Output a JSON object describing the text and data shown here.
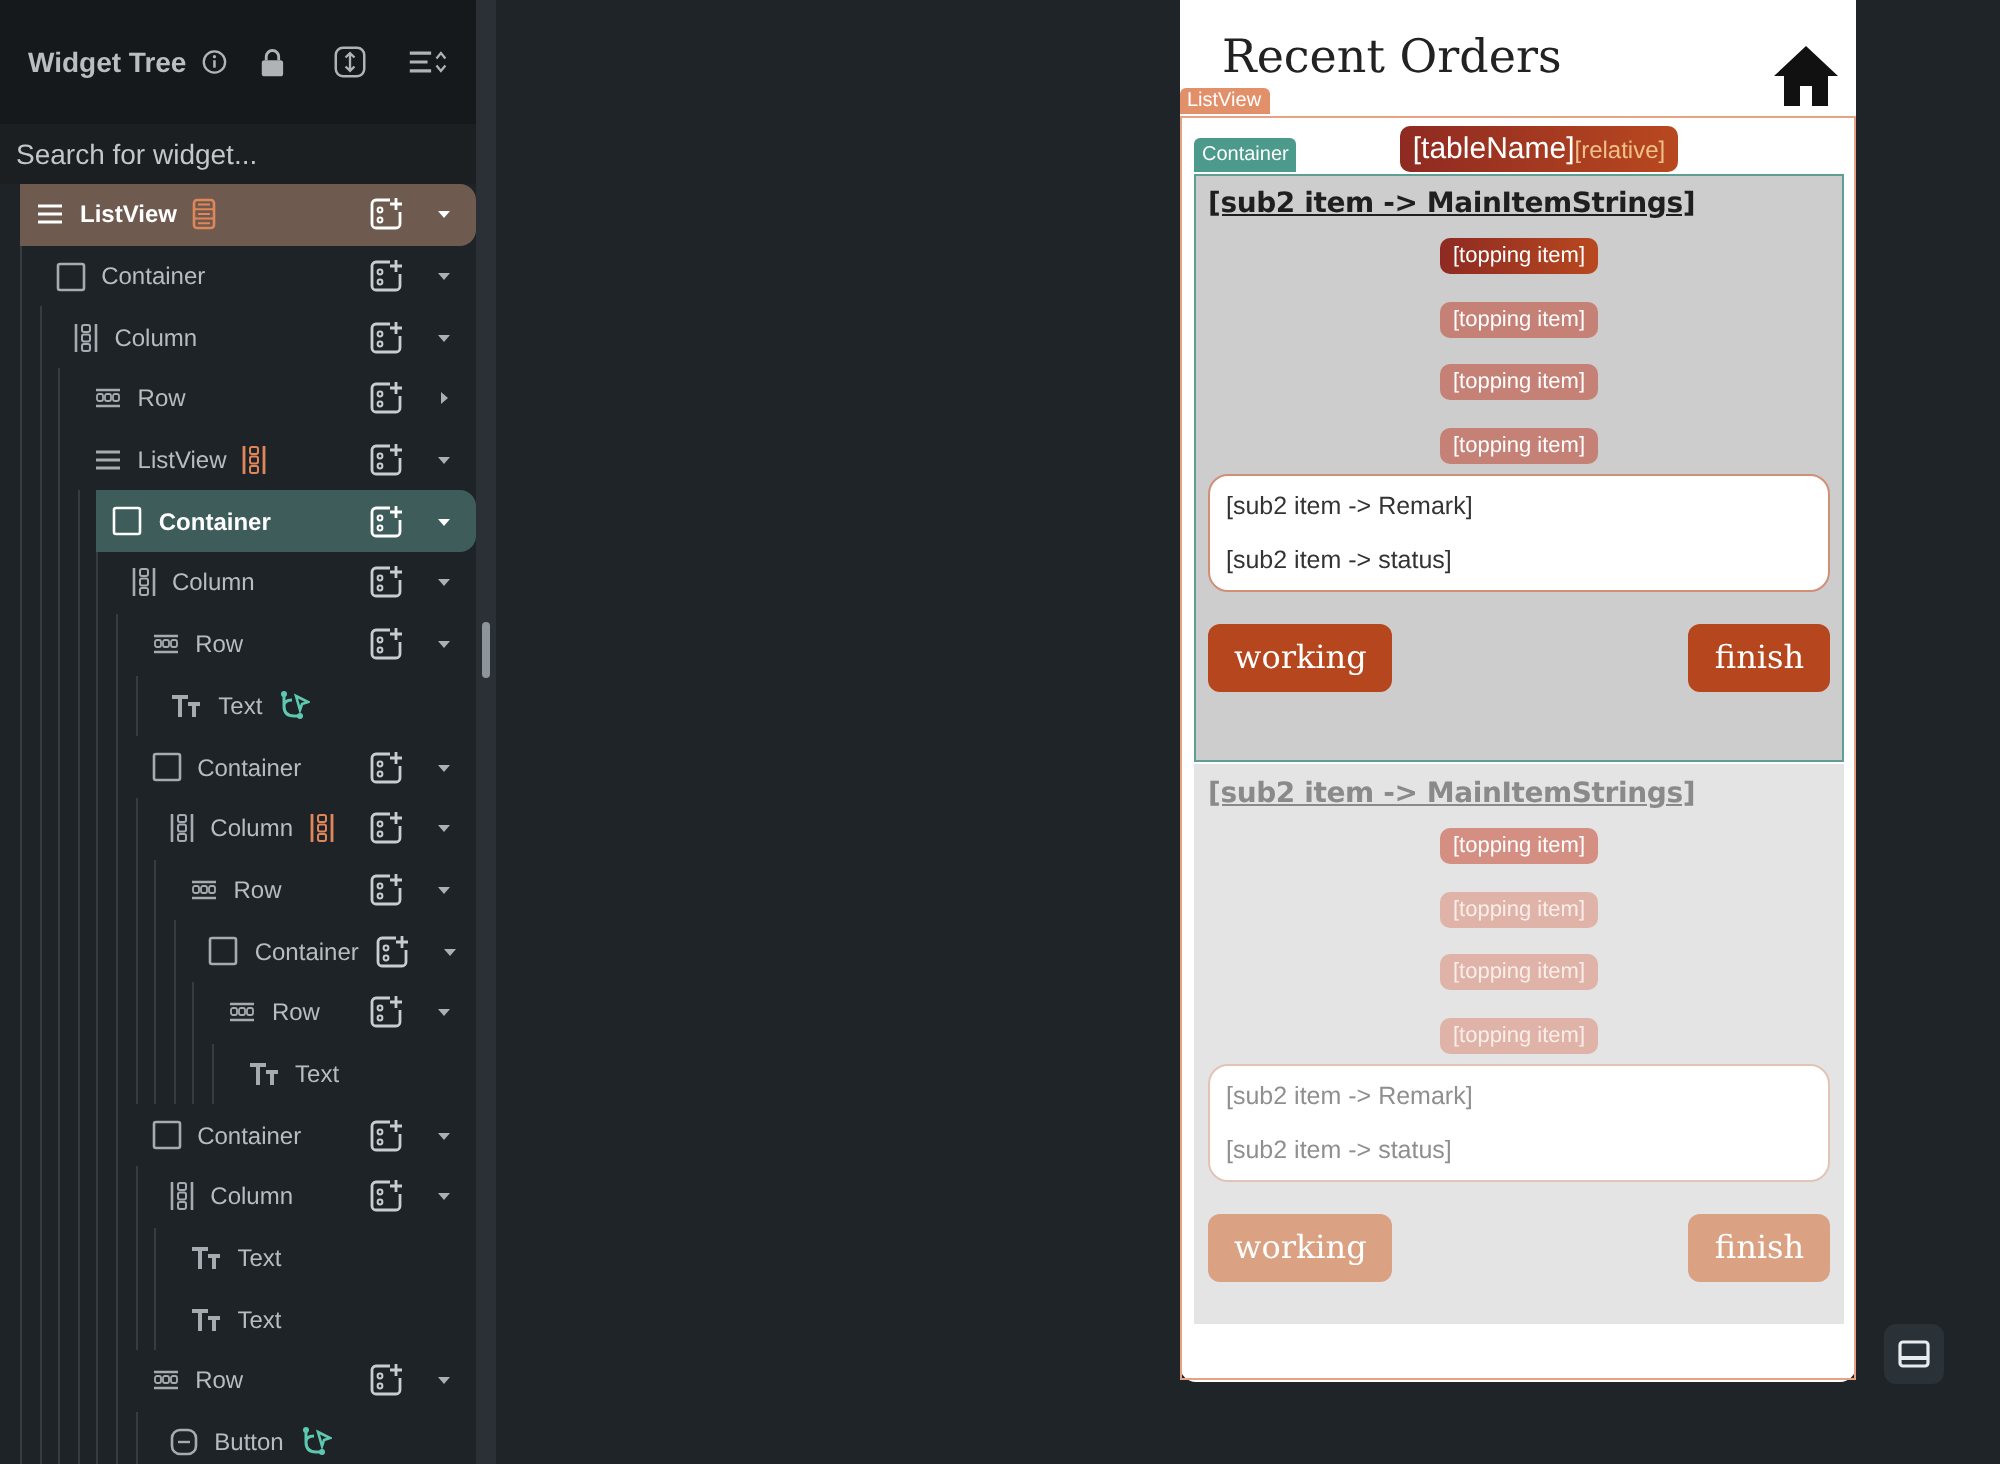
{
  "widget_tree": {
    "title": "Widget Tree",
    "search": {
      "placeholder": "Search for widget..."
    },
    "items": [
      {
        "kind": "listview",
        "label": "ListView",
        "highlighted": true,
        "selected": false,
        "badge": {
          "kind": "list"
        },
        "addable": true,
        "expanded": true,
        "children": [
          {
            "kind": "container",
            "label": "Container",
            "highlighted": false,
            "selected": false,
            "addable": true,
            "expanded": true,
            "children": [
              {
                "kind": "column",
                "label": "Column",
                "highlighted": false,
                "selected": false,
                "addable": true,
                "expanded": true,
                "children": [
                  {
                    "kind": "row",
                    "label": "Row",
                    "highlighted": false,
                    "selected": false,
                    "addable": true,
                    "expanded": false
                  },
                  {
                    "kind": "listview",
                    "label": "ListView",
                    "highlighted": false,
                    "selected": false,
                    "badge": {
                      "kind": "column"
                    },
                    "addable": true,
                    "expanded": true,
                    "children": [
                      {
                        "kind": "container",
                        "label": "Container",
                        "highlighted": false,
                        "selected": true,
                        "addable": true,
                        "expanded": true,
                        "children": [
                          {
                            "kind": "column",
                            "label": "Column",
                            "highlighted": false,
                            "selected": false,
                            "addable": true,
                            "expanded": true,
                            "children": [
                              {
                                "kind": "row",
                                "label": "Row",
                                "highlighted": false,
                                "selected": false,
                                "addable": true,
                                "expanded": true,
                                "children": [
                                  {
                                    "kind": "text",
                                    "label": "Text",
                                    "highlighted": false,
                                    "selected": false,
                                    "badge": {
                                      "kind": "action"
                                    },
                                    "addable": false
                                  }
                                ]
                              },
                              {
                                "kind": "container",
                                "label": "Container",
                                "highlighted": false,
                                "selected": false,
                                "addable": true,
                                "expanded": true,
                                "children": [
                                  {
                                    "kind": "column",
                                    "label": "Column",
                                    "highlighted": false,
                                    "selected": false,
                                    "badge": {
                                      "kind": "column"
                                    },
                                    "addable": true,
                                    "expanded": true,
                                    "children": [
                                      {
                                        "kind": "row",
                                        "label": "Row",
                                        "highlighted": false,
                                        "selected": false,
                                        "addable": true,
                                        "expanded": true,
                                        "children": [
                                          {
                                            "kind": "container",
                                            "label": "Container",
                                            "highlighted": false,
                                            "selected": false,
                                            "addable": true,
                                            "expanded": true,
                                            "children": [
                                              {
                                                "kind": "row",
                                                "label": "Row",
                                                "highlighted": false,
                                                "selected": false,
                                                "addable": true,
                                                "expanded": true,
                                                "children": [
                                                  {
                                                    "kind": "text",
                                                    "label": "Text",
                                                    "highlighted": false,
                                                    "selected": false,
                                                    "addable": false
                                                  }
                                                ]
                                              }
                                            ]
                                          }
                                        ]
                                      }
                                    ]
                                  }
                                ]
                              },
                              {
                                "kind": "container",
                                "label": "Container",
                                "highlighted": false,
                                "selected": false,
                                "addable": true,
                                "expanded": true,
                                "children": [
                                  {
                                    "kind": "column",
                                    "label": "Column",
                                    "highlighted": false,
                                    "selected": false,
                                    "addable": true,
                                    "expanded": true,
                                    "children": [
                                      {
                                        "kind": "text",
                                        "label": "Text",
                                        "highlighted": false,
                                        "selected": false,
                                        "addable": false
                                      },
                                      {
                                        "kind": "text",
                                        "label": "Text",
                                        "highlighted": false,
                                        "selected": false,
                                        "addable": false
                                      }
                                    ]
                                  }
                                ]
                              },
                              {
                                "kind": "row",
                                "label": "Row",
                                "highlighted": false,
                                "selected": false,
                                "addable": true,
                                "expanded": true,
                                "children": [
                                  {
                                    "kind": "button",
                                    "label": "Button",
                                    "highlighted": false,
                                    "selected": false,
                                    "badge": {
                                      "kind": "action"
                                    },
                                    "addable": false
                                  }
                                ]
                              }
                            ]
                          }
                        ]
                      }
                    ]
                  }
                ]
              }
            ]
          }
        ]
      }
    ]
  },
  "preview": {
    "title": "Recent Orders",
    "listview_tag": "ListView",
    "container_tag": "Container",
    "table_name": "[tableName]",
    "table_name_suffix": "[relative]",
    "orders": [
      {
        "selected": true,
        "faded": false,
        "title": "[sub2 item -> MainItemStrings]",
        "toppings": [
          {
            "label": "[topping item]",
            "emphasized": true
          },
          {
            "label": "[topping item]",
            "emphasized": false
          },
          {
            "label": "[topping item]",
            "emphasized": false
          },
          {
            "label": "[topping item]",
            "emphasized": false
          }
        ],
        "remark": "[sub2 item -> Remark]",
        "status": "[sub2 item -> status]",
        "buttons": [
          "working",
          "finish"
        ]
      },
      {
        "selected": false,
        "faded": true,
        "title": "[sub2 item -> MainItemStrings]",
        "toppings": [
          {
            "label": "[topping item]",
            "emphasized": true
          },
          {
            "label": "[topping item]",
            "emphasized": false
          },
          {
            "label": "[topping item]",
            "emphasized": false
          },
          {
            "label": "[topping item]",
            "emphasized": false
          }
        ],
        "remark": "[sub2 item -> Remark]",
        "status": "[sub2 item -> status]",
        "buttons": [
          "working",
          "finish"
        ]
      }
    ]
  }
}
